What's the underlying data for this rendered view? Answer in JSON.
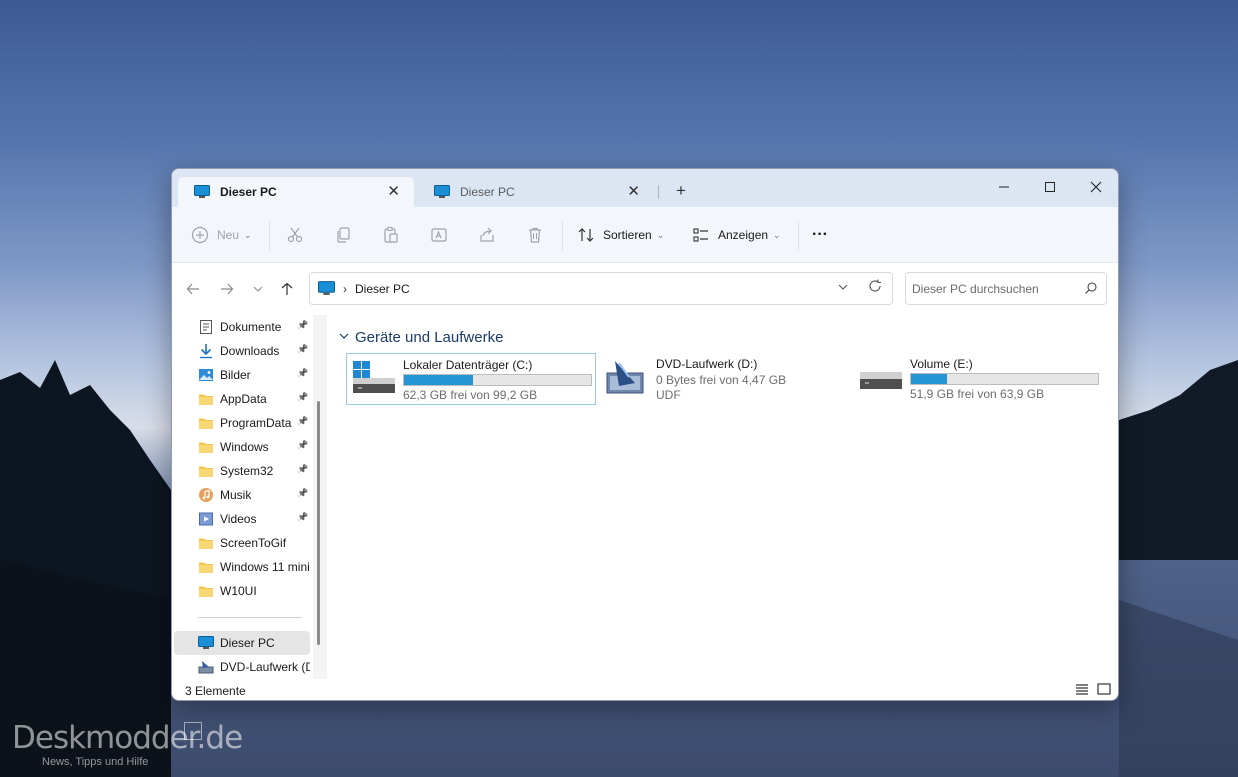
{
  "window": {
    "tabs": [
      {
        "label": "Dieser PC",
        "active": true
      },
      {
        "label": "Dieser PC",
        "active": false
      }
    ],
    "new_tab_glyph": "+",
    "close_glyph": "✕"
  },
  "toolbar": {
    "new_label": "Neu",
    "sort_label": "Sortieren",
    "view_label": "Anzeigen",
    "more_glyph": "···"
  },
  "address": {
    "crumb": "Dieser PC",
    "separator": "›",
    "search_placeholder": "Dieser PC durchsuchen"
  },
  "sidebar": {
    "items": [
      {
        "label": "Dokumente",
        "icon": "document-icon",
        "pinned": true
      },
      {
        "label": "Downloads",
        "icon": "download-icon",
        "pinned": true
      },
      {
        "label": "Bilder",
        "icon": "pictures-icon",
        "pinned": true
      },
      {
        "label": "AppData",
        "icon": "folder-icon",
        "pinned": true
      },
      {
        "label": "ProgramData",
        "icon": "folder-icon",
        "pinned": true
      },
      {
        "label": "Windows",
        "icon": "folder-icon",
        "pinned": true
      },
      {
        "label": "System32",
        "icon": "folder-icon",
        "pinned": true
      },
      {
        "label": "Musik",
        "icon": "music-icon",
        "pinned": true
      },
      {
        "label": "Videos",
        "icon": "video-icon",
        "pinned": true
      },
      {
        "label": "ScreenToGif",
        "icon": "folder-icon",
        "pinned": false
      },
      {
        "label": "Windows 11 mini",
        "icon": "folder-icon",
        "pinned": false
      },
      {
        "label": "W10UI",
        "icon": "folder-icon",
        "pinned": false
      }
    ],
    "this_pc": "Dieser PC",
    "dvd": "DVD-Laufwerk (D:"
  },
  "content": {
    "group_title": "Geräte und Laufwerke",
    "drives": [
      {
        "name": "Lokaler Datenträger (C:)",
        "free_text": "62,3 GB frei von 99,2 GB",
        "used_fraction": 0.37,
        "icon": "windows-drive-icon"
      },
      {
        "name": "DVD-Laufwerk (D:)",
        "free_text": "0 Bytes frei von 4,47 GB",
        "fs": "UDF",
        "icon": "dvd-drive-icon"
      },
      {
        "name": "Volume (E:)",
        "free_text": "51,9 GB frei von 63,9 GB",
        "used_fraction": 0.19,
        "icon": "hard-drive-icon"
      }
    ]
  },
  "status": {
    "count": "3 Elemente"
  },
  "watermark": {
    "title": "Deskmodder.de",
    "subtitle": "News, Tipps und Hilfe"
  },
  "colors": {
    "accent": "#2595d3",
    "group_header": "#1d3b69",
    "titlebar": "#dce6f3"
  }
}
